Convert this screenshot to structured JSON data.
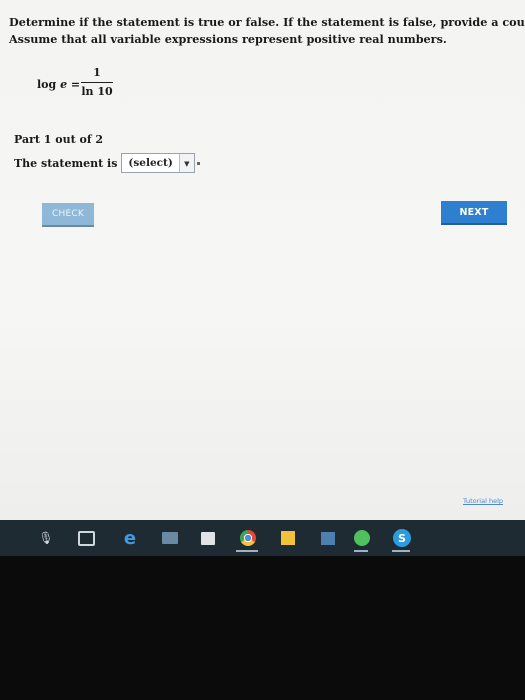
{
  "problem": {
    "line1": "Determine if the statement is true or false. If the statement is false, provide a counterexample.",
    "line2": "Assume that all variable expressions represent positive real numbers."
  },
  "formula": {
    "lhs_log": "log",
    "lhs_var": "e",
    "equals": "=",
    "numerator": "1",
    "denominator": "ln 10"
  },
  "part": {
    "label": "Part 1 out of 2"
  },
  "statement": {
    "prefix": "The statement is",
    "select_value": "(select)"
  },
  "buttons": {
    "check": "CHECK",
    "next": "NEXT"
  },
  "footer": {
    "tutorial": "Tutorial help"
  },
  "taskbar": {
    "skype_letter": "S",
    "edge_letter": "e",
    "mic_glyph": "🎙",
    "colors": {
      "chrome_active_bg": "#4a5560",
      "background": "#1f2b33"
    }
  },
  "colors": {
    "next_button": "#2f7fd1",
    "check_button": "#8fb8d8",
    "link": "#4f87c9"
  }
}
